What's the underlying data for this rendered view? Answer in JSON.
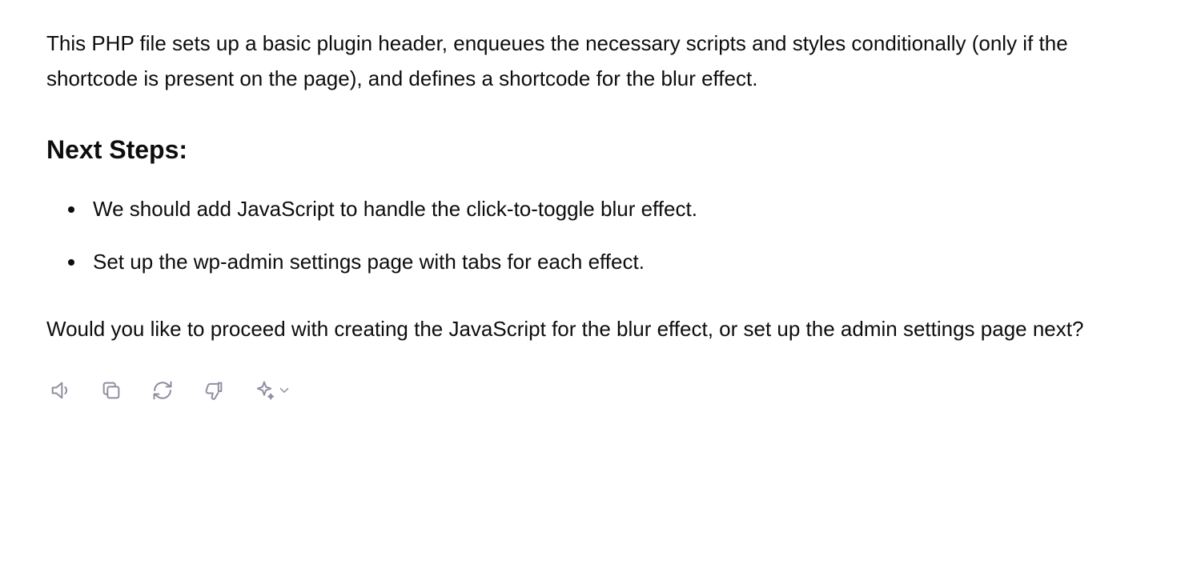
{
  "paragraphs": {
    "intro": "This PHP file sets up a basic plugin header, enqueues the necessary scripts and styles conditionally (only if the shortcode is present on the page), and defines a shortcode for the blur effect.",
    "closing": "Would you like to proceed with creating the JavaScript for the blur effect, or set up the admin settings page next?"
  },
  "heading": "Next Steps:",
  "bullets": [
    "We should add JavaScript to handle the click-to-toggle blur effect.",
    "Set up the wp-admin settings page with tabs for each effect."
  ],
  "icons": {
    "read_aloud": "speaker-icon",
    "copy": "copy-icon",
    "regenerate": "refresh-icon",
    "bad_response": "thumbs-down-icon",
    "model": "sparkle-icon"
  }
}
